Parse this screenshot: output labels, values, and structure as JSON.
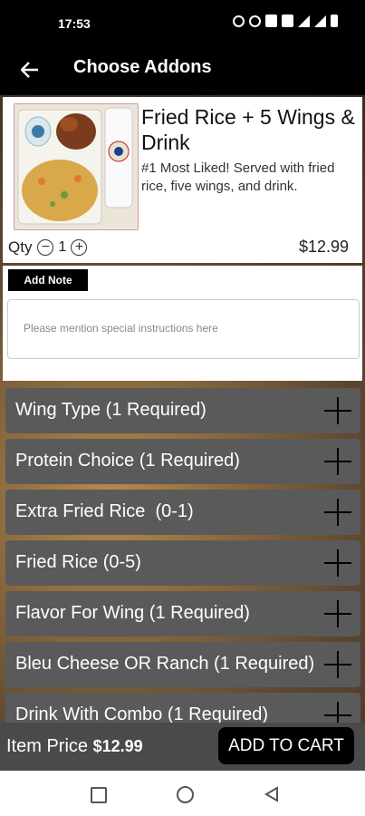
{
  "status": {
    "time": "17:53"
  },
  "header": {
    "title": "Choose Addons",
    "back_icon": "arrow-left-icon"
  },
  "product": {
    "title": "Fried Rice + 5 Wings & Drink",
    "description": "#1 Most Liked! Served with fried rice, five wings, and drink.",
    "qty_label": "Qty",
    "qty_value": "1",
    "price": "$12.99"
  },
  "note": {
    "tab_label": "Add Note",
    "placeholder": "Please mention special instructions here"
  },
  "addons": [
    {
      "label": "Wing Type (1 Required)"
    },
    {
      "label": "Protein Choice (1 Required)"
    },
    {
      "label": "Extra Fried Rice  (0-1)"
    },
    {
      "label": "Fried Rice (0-5)"
    },
    {
      "label": "Flavor For Wing (1 Required)"
    },
    {
      "label": "Bleu Cheese OR Ranch (1 Required)"
    },
    {
      "label": "Drink With Combo (1 Required)"
    }
  ],
  "footer": {
    "item_price_label": "Item Price",
    "item_price_value": "$12.99",
    "add_to_cart_label": "ADD TO CART"
  },
  "colors": {
    "accent": "#000000",
    "addon_row": "#5a5a5a",
    "footer": "#4a4a4a"
  }
}
